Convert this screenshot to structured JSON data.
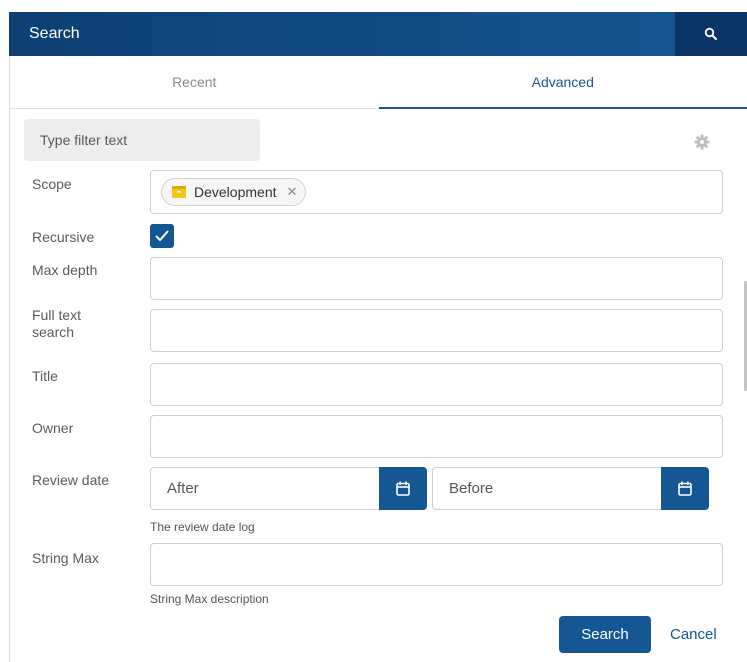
{
  "header": {
    "title": "Search",
    "search_icon": "search-icon"
  },
  "tabs": [
    {
      "label": "Recent",
      "active": false
    },
    {
      "label": "Advanced",
      "active": true
    }
  ],
  "filter": {
    "placeholder": "Type filter text",
    "settings_icon": "gear-icon"
  },
  "form": {
    "scope": {
      "label": "Scope",
      "chips": [
        {
          "label": "Development",
          "icon": "folder-icon",
          "icon_color": "#f5c518"
        }
      ]
    },
    "recursive": {
      "label": "Recursive",
      "checked": true
    },
    "max_depth": {
      "label": "Max depth",
      "value": ""
    },
    "full_text_search": {
      "label": "Full text search",
      "value": ""
    },
    "title": {
      "label": "Title",
      "value": ""
    },
    "owner": {
      "label": "Owner",
      "value": ""
    },
    "review_date": {
      "label": "Review date",
      "after_placeholder": "After",
      "before_placeholder": "Before",
      "hint": "The review date log",
      "icon": "calendar-icon"
    },
    "string_max": {
      "label": "String Max",
      "value": "",
      "hint": "String Max description"
    }
  },
  "actions": {
    "search_label": "Search",
    "cancel_label": "Cancel"
  },
  "colors": {
    "primary": "#155694",
    "header": "#0d3f73",
    "chip_icon": "#f5c518"
  }
}
